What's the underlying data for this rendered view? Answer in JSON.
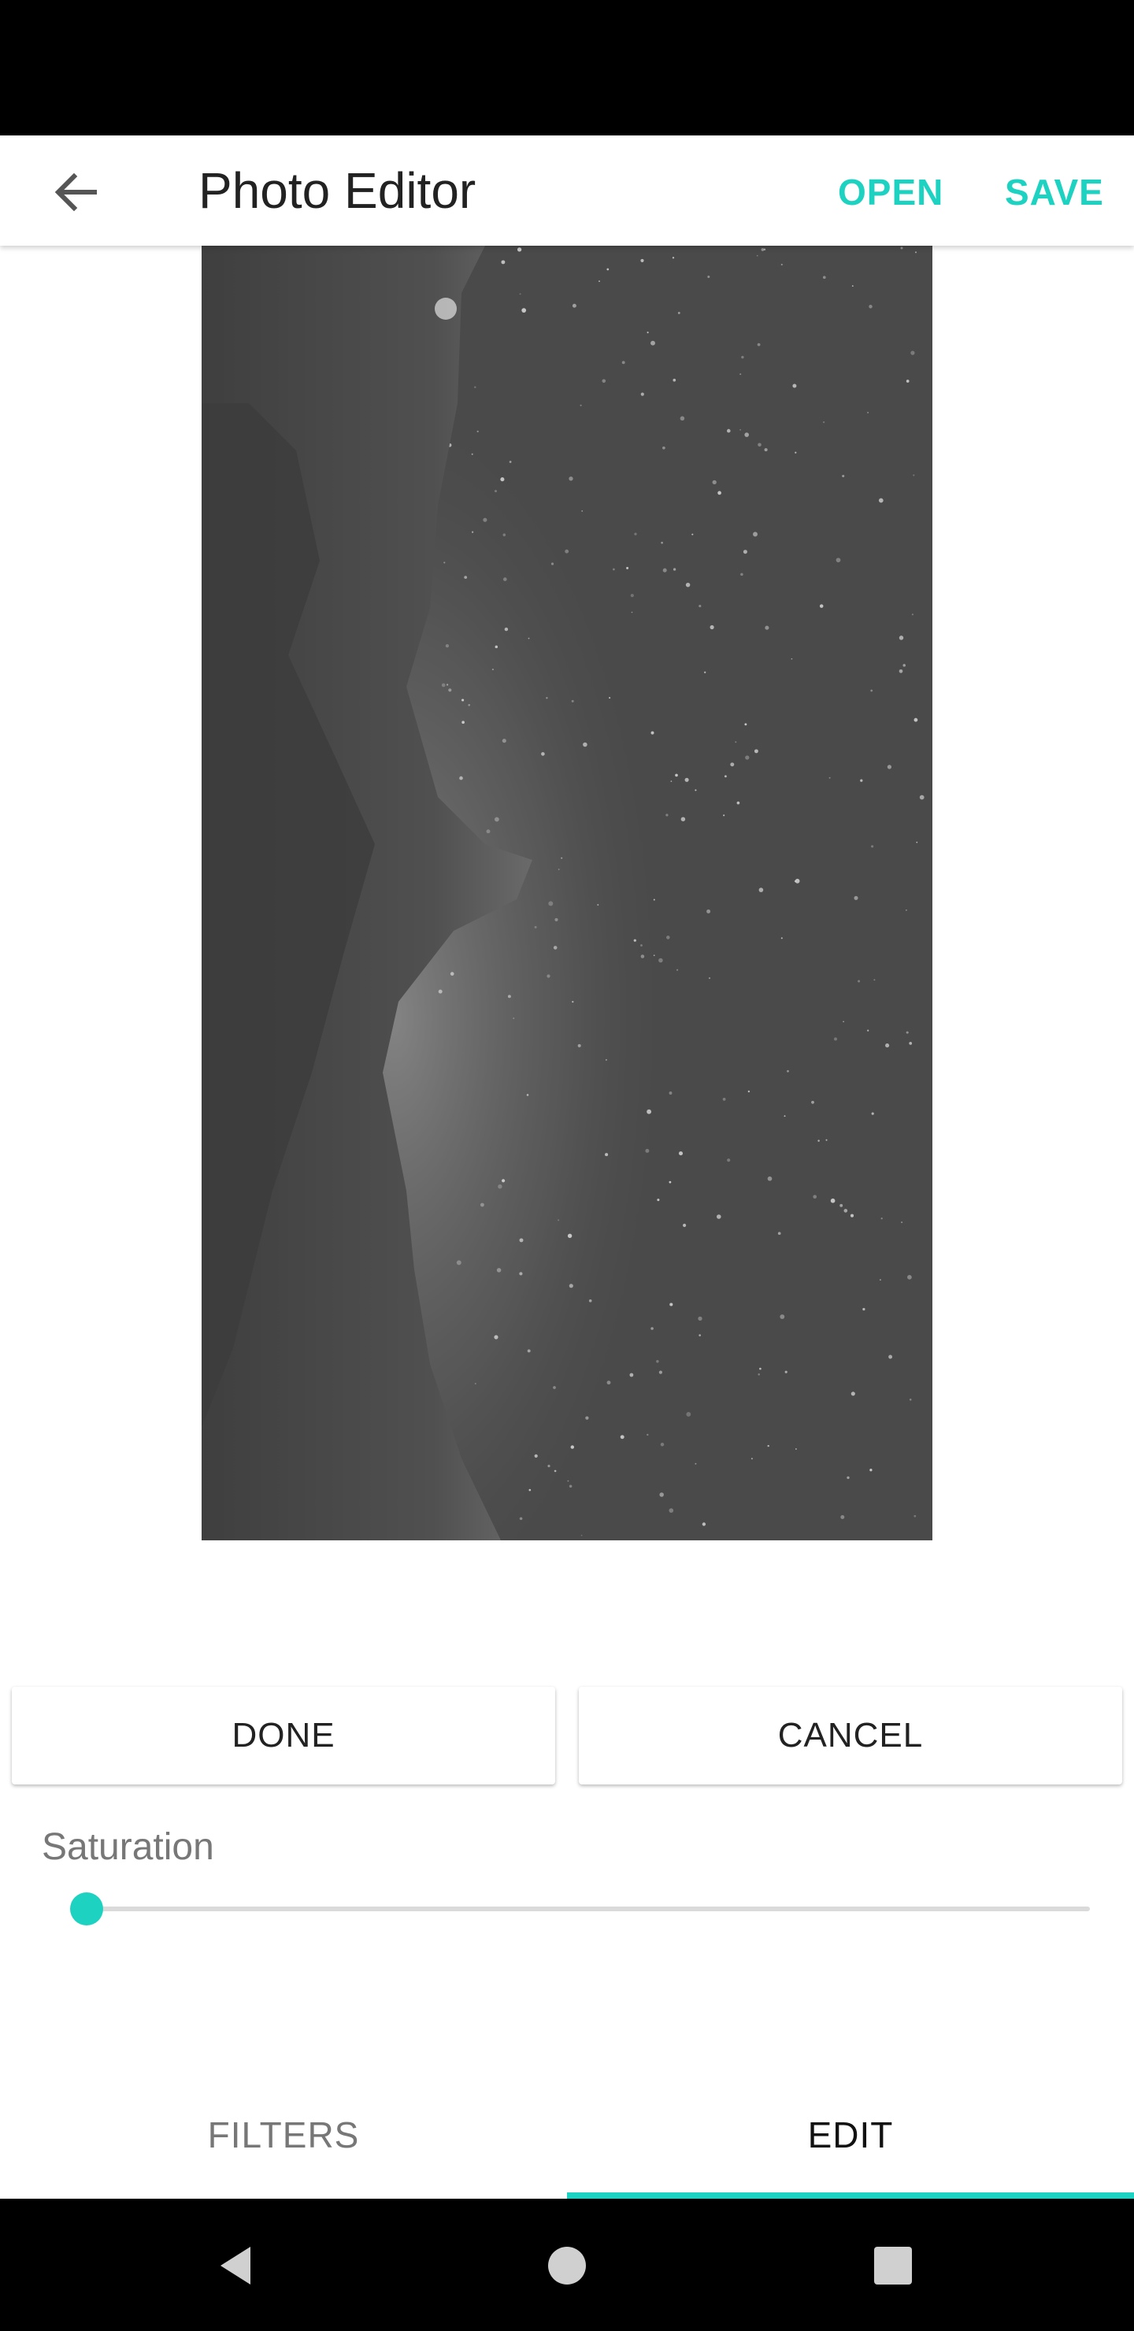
{
  "app_bar": {
    "title": "Photo Editor",
    "open_label": "OPEN",
    "save_label": "SAVE",
    "back_icon": "arrow-back-icon"
  },
  "editor": {
    "done_label": "DONE",
    "cancel_label": "CANCEL",
    "slider_label": "Saturation",
    "slider_value_fraction": 0.0
  },
  "tabs": [
    {
      "label": "FILTERS",
      "selected": false
    },
    {
      "label": "EDIT",
      "selected": true
    }
  ],
  "colors": {
    "accent": "#1dd2c1",
    "photo_background": "#4a4a4a"
  },
  "navigation": {
    "icons": [
      "nav-back-icon",
      "nav-home-icon",
      "nav-recents-icon"
    ]
  }
}
